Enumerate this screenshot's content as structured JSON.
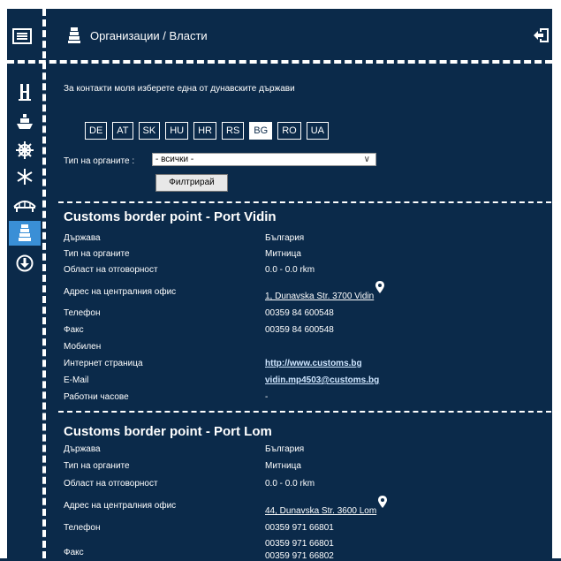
{
  "header": {
    "title": "Организации / Власти",
    "menu_icon": "menu-icon",
    "title_icon": "beacon-icon",
    "logout_icon": "logout-icon"
  },
  "sidebar": {
    "items": [
      {
        "name": "lock-gate-icon",
        "active": false
      },
      {
        "name": "ship-icon",
        "active": false
      },
      {
        "name": "ship-wheel-icon",
        "active": false
      },
      {
        "name": "snowflake-icon",
        "active": false
      },
      {
        "name": "bridge-icon",
        "active": false
      },
      {
        "name": "beacon-icon",
        "active": true
      },
      {
        "name": "download-icon",
        "active": false
      }
    ]
  },
  "intro": "За контакти моля изберете една от дунавските държави",
  "countries": [
    "DE",
    "AT",
    "SK",
    "HU",
    "HR",
    "RS",
    "BG",
    "RO",
    "UA"
  ],
  "selected_country": "BG",
  "filter": {
    "type_label": "Тип на органите :",
    "type_value": "- всички -",
    "button": "Филтрирай"
  },
  "entries": [
    {
      "title": "Customs border point - Port Vidin",
      "rows": [
        {
          "label": "Държава",
          "value": "България"
        },
        {
          "label": "Тип на органите",
          "value": "Митница"
        },
        {
          "label": "Област на отговорност",
          "value": "0.0 - 0.0 rkm"
        },
        {
          "label": "Адрес на централния офис",
          "value": "1, Dunavska Str. 3700 Vidin"
        },
        {
          "label": "Телефон",
          "value": "00359 84 600548"
        },
        {
          "label": "Факс",
          "value": "00359 84 600548"
        },
        {
          "label": "Мобилен",
          "value": ""
        },
        {
          "label": "Интернет страница",
          "value": "http://www.customs.bg"
        },
        {
          "label": "E-Mail",
          "value": "vidin.mp4503@customs.bg"
        },
        {
          "label": "Работни часове",
          "value": "-"
        }
      ]
    },
    {
      "title": "Customs border point - Port Lom",
      "rows": [
        {
          "label": "Държава",
          "value": "България"
        },
        {
          "label": "Тип на органите",
          "value": "Митница"
        },
        {
          "label": "Област на отговорност",
          "value": "0.0 - 0.0 rkm"
        },
        {
          "label": "Адрес на централния офис",
          "value": "44, Dunavska Str. 3600 Lom"
        },
        {
          "label": "Телефон",
          "value": "00359 971 66801"
        },
        {
          "label": "Факс",
          "value": "00359 971 66801",
          "value2": "00359 971 66802"
        }
      ]
    }
  ]
}
